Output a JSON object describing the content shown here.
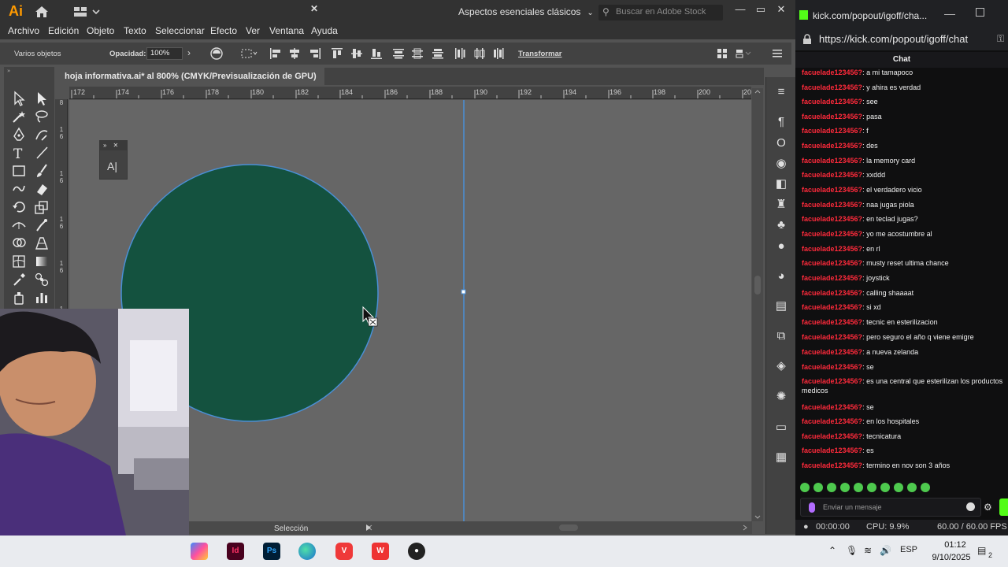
{
  "illustrator": {
    "logo": "Ai",
    "workspace": "Aspectos esenciales clásicos",
    "stock_placeholder": "Buscar en Adobe Stock",
    "menu": [
      "Archivo",
      "Edición",
      "Objeto",
      "Texto",
      "Seleccionar",
      "Efecto",
      "Ver",
      "Ventana",
      "Ayuda"
    ],
    "control": {
      "selection": "Varios objetos",
      "opacity_label": "Opacidad:",
      "opacity_value": "100%",
      "transform": "Transformar"
    },
    "doc_tab": "hoja informativa.ai* al 800% (CMYK/Previsualización de GPU)",
    "ruler_top": [
      "172",
      "174",
      "176",
      "178",
      "180",
      "182",
      "184",
      "186",
      "188",
      "190",
      "192",
      "194",
      "196",
      "198",
      "200",
      "20"
    ],
    "ruler_left": [
      "8",
      "1 6",
      "1 6",
      "1 6",
      "1 6",
      "1 6",
      "1 6"
    ],
    "status": "Selección",
    "artwork": {
      "circle_fill": "#14523f",
      "circle_stroke": "#4a8fd6"
    }
  },
  "kick": {
    "title": "kick.com/popout/igoff/cha...",
    "url": "https://kick.com/popout/igoff/chat",
    "chat_header": "Chat",
    "username": "facuelade123456?",
    "messages": [
      "a mi tamapoco",
      "y ahira es verdad",
      "see",
      "pasa",
      "f",
      "des",
      "la memory card",
      "xxddd",
      "el verdadero vicio",
      "naa jugas piola",
      "en teclad jugas?",
      "yo me acostumbre al",
      "en rl",
      "musty reset ultima chance",
      "joystick",
      "calling shaaaat",
      "si xd",
      "tecnic en esterilizacion",
      "pero seguro el año q viene emigre",
      "a nueva zelanda",
      "se",
      "es una central que esterilizan los productos medicos",
      "se",
      "en los hospitales",
      "tecnicatura",
      "es",
      "termino en nov son 3 años"
    ],
    "input_placeholder": "Enviar un mensaje",
    "stats": {
      "time": "00:00:00",
      "cpu": "CPU: 9.9%",
      "fps": "60.00 / 60.00 FPS"
    },
    "accent": "#53fc18",
    "username_color": "#ff2a3b"
  },
  "taskbar": {
    "apps": [
      "copilot",
      "Id",
      "Ps",
      "edge",
      "vivaldi",
      "wps",
      "obs"
    ],
    "language": "ESP",
    "time": "01:12",
    "date": "9/10/2025",
    "notification_count": "2"
  }
}
